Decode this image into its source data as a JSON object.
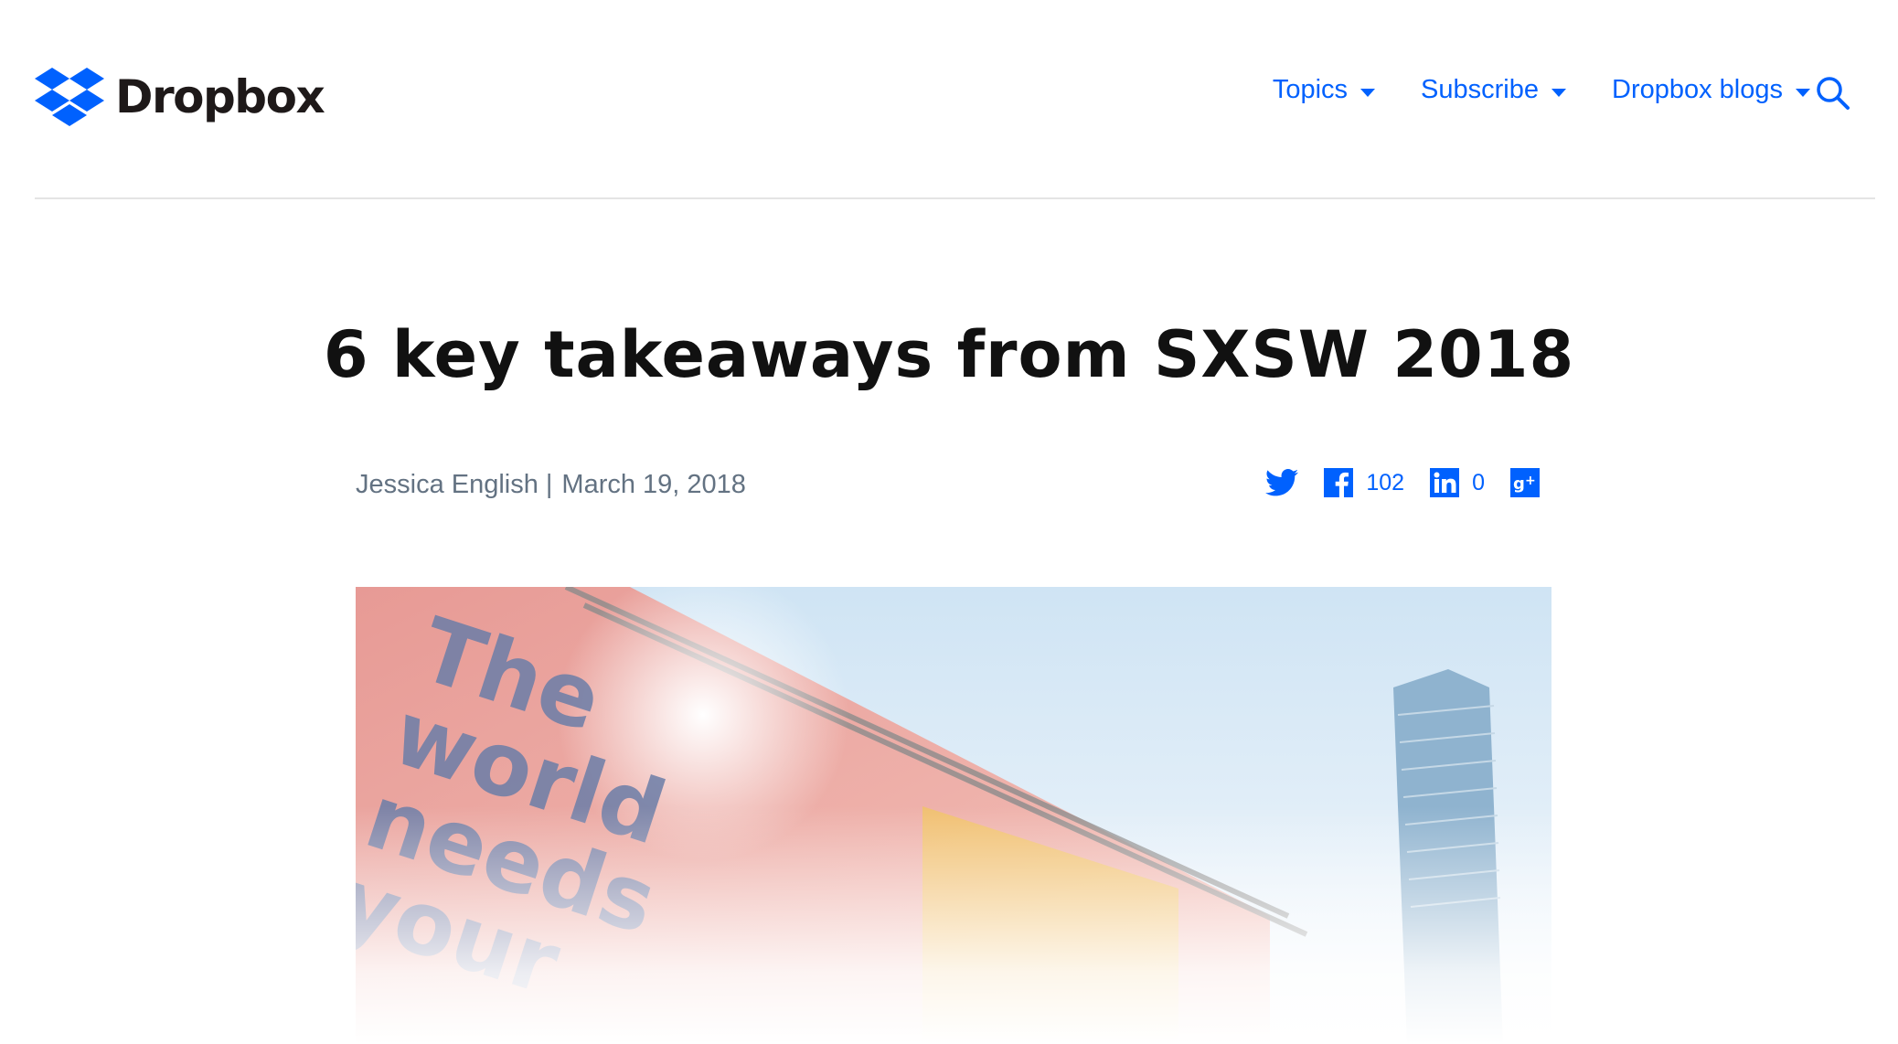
{
  "brand": {
    "name": "Dropbox",
    "accent": "#0061fe"
  },
  "nav": {
    "items": [
      {
        "label": "Topics"
      },
      {
        "label": "Subscribe"
      },
      {
        "label": "Dropbox blogs"
      }
    ],
    "search_icon": "search-icon"
  },
  "article": {
    "title": "6 key takeaways from SXSW 2018",
    "author": "Jessica English",
    "separator": "|",
    "date": "March 19, 2018"
  },
  "social": {
    "twitter": {
      "icon": "twitter-icon"
    },
    "facebook": {
      "icon": "facebook-icon",
      "count": "102"
    },
    "linkedin": {
      "icon": "linkedin-icon",
      "count": "0"
    },
    "googleplus": {
      "icon": "google-plus-icon"
    }
  },
  "hero": {
    "lines": [
      "The",
      "world",
      "needs",
      "your"
    ]
  }
}
